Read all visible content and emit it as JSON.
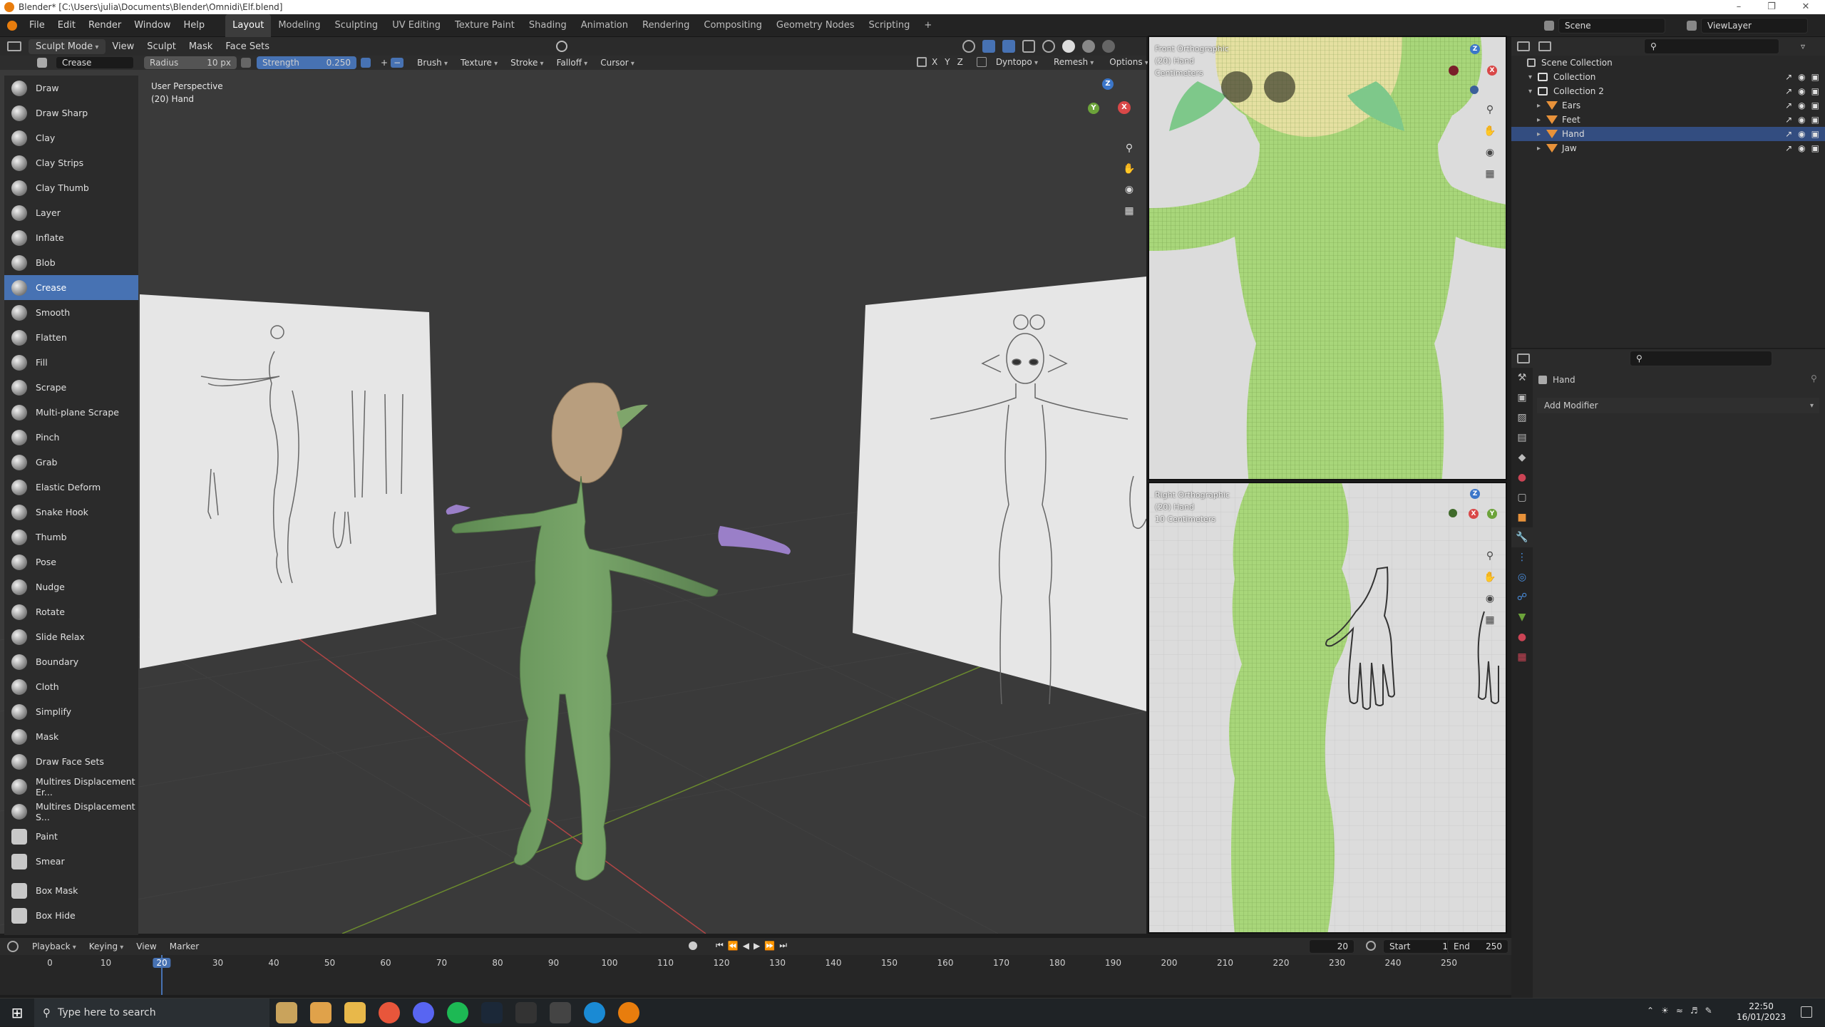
{
  "window": {
    "title": "Blender* [C:\\Users\\julia\\Documents\\Blender\\Omnidi\\Elf.blend]",
    "minimize": "–",
    "maximize": "❐",
    "close": "✕"
  },
  "menu": [
    "File",
    "Edit",
    "Render",
    "Window",
    "Help"
  ],
  "workspaces": [
    "Layout",
    "Modeling",
    "Sculpting",
    "UV Editing",
    "Texture Paint",
    "Shading",
    "Animation",
    "Rendering",
    "Compositing",
    "Geometry Nodes",
    "Scripting"
  ],
  "workspace_add": "+",
  "scene": {
    "label": "Scene",
    "view_layer": "ViewLayer"
  },
  "viewport_header": {
    "mode": "Sculpt Mode",
    "items": [
      "View",
      "Sculpt",
      "Mask",
      "Face Sets"
    ]
  },
  "tool_settings": {
    "brush_name": "Crease",
    "radius_label": "Radius",
    "radius_value": "10 px",
    "strength_label": "Strength",
    "strength_value": "0.250",
    "plus": "+",
    "minus": "−",
    "menus": [
      "Brush",
      "Texture",
      "Stroke",
      "Falloff",
      "Cursor"
    ],
    "axes": [
      "X",
      "Y",
      "Z"
    ],
    "right_menus": [
      "Dyntopo",
      "Remesh",
      "Options"
    ]
  },
  "viewport_info": {
    "line1": "User Perspective",
    "line2": "(20) Hand"
  },
  "gizmo": {
    "x": "X",
    "y": "Y",
    "z": "Z"
  },
  "tools": [
    {
      "label": "Draw",
      "icon": "draw-brush-icon"
    },
    {
      "label": "Draw Sharp",
      "icon": "draw-sharp-brush-icon"
    },
    {
      "label": "Clay",
      "icon": "clay-brush-icon"
    },
    {
      "label": "Clay Strips",
      "icon": "clay-strips-brush-icon"
    },
    {
      "label": "Clay Thumb",
      "icon": "clay-thumb-brush-icon"
    },
    {
      "label": "Layer",
      "icon": "layer-brush-icon"
    },
    {
      "label": "Inflate",
      "icon": "inflate-brush-icon"
    },
    {
      "label": "Blob",
      "icon": "blob-brush-icon"
    },
    {
      "label": "Crease",
      "icon": "crease-brush-icon",
      "active": true
    },
    {
      "label": "Smooth",
      "icon": "smooth-brush-icon"
    },
    {
      "label": "Flatten",
      "icon": "flatten-brush-icon"
    },
    {
      "label": "Fill",
      "icon": "fill-brush-icon"
    },
    {
      "label": "Scrape",
      "icon": "scrape-brush-icon"
    },
    {
      "label": "Multi-plane Scrape",
      "icon": "multiplane-scrape-brush-icon"
    },
    {
      "label": "Pinch",
      "icon": "pinch-brush-icon"
    },
    {
      "label": "Grab",
      "icon": "grab-brush-icon"
    },
    {
      "label": "Elastic Deform",
      "icon": "elastic-deform-brush-icon"
    },
    {
      "label": "Snake Hook",
      "icon": "snake-hook-brush-icon"
    },
    {
      "label": "Thumb",
      "icon": "thumb-brush-icon"
    },
    {
      "label": "Pose",
      "icon": "pose-brush-icon"
    },
    {
      "label": "Nudge",
      "icon": "nudge-brush-icon"
    },
    {
      "label": "Rotate",
      "icon": "rotate-brush-icon"
    },
    {
      "label": "Slide Relax",
      "icon": "slide-relax-brush-icon"
    },
    {
      "label": "Boundary",
      "icon": "boundary-brush-icon"
    },
    {
      "label": "Cloth",
      "icon": "cloth-brush-icon"
    },
    {
      "label": "Simplify",
      "icon": "simplify-brush-icon"
    },
    {
      "label": "Mask",
      "icon": "mask-brush-icon"
    },
    {
      "label": "Draw Face Sets",
      "icon": "draw-face-sets-brush-icon"
    },
    {
      "label": "Multires Displacement Er...",
      "icon": "multires-eraser-brush-icon"
    },
    {
      "label": "Multires Displacement S...",
      "icon": "multires-smear-brush-icon"
    },
    {
      "label": "Paint",
      "icon": "paint-brush-icon"
    },
    {
      "label": "Smear",
      "icon": "smear-brush-icon"
    },
    {
      "label": "Box Mask",
      "icon": "box-mask-icon",
      "sep": true
    },
    {
      "label": "Box Hide",
      "icon": "box-hide-icon"
    }
  ],
  "ortho_top": {
    "line1": "Front Orthographic",
    "line2": "(20) Hand",
    "line3": "Centimeters"
  },
  "ortho_bottom": {
    "line1": "Right Orthographic",
    "line2": "(20) Hand",
    "line3": "10 Centimeters"
  },
  "outliner": {
    "root": "Scene Collection",
    "items": [
      {
        "label": "Collection",
        "depth": 1,
        "kind": "collection"
      },
      {
        "label": "Collection 2",
        "depth": 1,
        "kind": "collection"
      },
      {
        "label": "Ears",
        "depth": 2,
        "kind": "object"
      },
      {
        "label": "Feet",
        "depth": 2,
        "kind": "object"
      },
      {
        "label": "Hand",
        "depth": 2,
        "kind": "object",
        "selected": true
      },
      {
        "label": "Jaw",
        "depth": 2,
        "kind": "object"
      }
    ]
  },
  "properties": {
    "object_name": "Hand",
    "add_modifier": "Add Modifier"
  },
  "timeline": {
    "menus": [
      "Playback",
      "Keying",
      "View",
      "Marker"
    ],
    "current_frame": "20",
    "start_label": "Start",
    "start_value": "1",
    "end_label": "End",
    "end_value": "250",
    "ticks": [
      "0",
      "10",
      "20",
      "30",
      "40",
      "50",
      "60",
      "70",
      "80",
      "90",
      "100",
      "110",
      "120",
      "130",
      "140",
      "150",
      "160",
      "170",
      "180",
      "190",
      "200",
      "210",
      "220",
      "230",
      "240",
      "250"
    ]
  },
  "taskbar": {
    "search_placeholder": "Type here to search",
    "time": "22:50",
    "date": "16/01/2023"
  },
  "colors": {
    "active": "#4772b3",
    "selected_row": "#334d80",
    "mesh": "#6e9a5e",
    "hand": "#9a7fc8",
    "head": "#b89e7e",
    "object_icon": "#e8923a"
  }
}
